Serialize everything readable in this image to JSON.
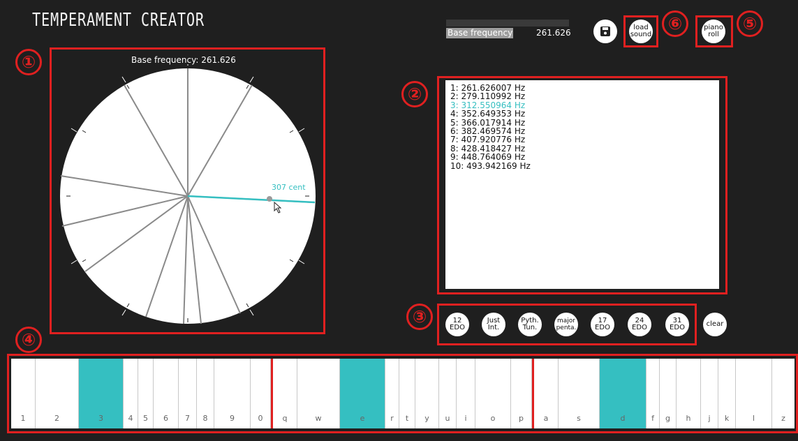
{
  "app": {
    "title": "TEMPERAMENT CREATOR"
  },
  "colors": {
    "accent": "#35bfc1",
    "highlight_red": "#e02020",
    "background": "#1f1f1f"
  },
  "header": {
    "base_frequency_label": "Base frequency",
    "base_frequency_value": "261.626",
    "save_icon": "floppy-disk-icon",
    "load_sound_label": "load\nsound",
    "piano_roll_label": "piano\nroll"
  },
  "annotations": [
    "①",
    "②",
    "③",
    "④",
    "⑤",
    "⑥"
  ],
  "circle_panel": {
    "title": "Base frequency: 261.626",
    "selected_label": "307 cent"
  },
  "frequency_list": {
    "items": [
      "1: 261.626007 Hz",
      "2: 279.110992 Hz",
      "3: 312.550964 Hz",
      "4: 352.649353 Hz",
      "5: 366.017914 Hz",
      "6: 382.469574 Hz",
      "7: 407.920776 Hz",
      "8: 428.418427 Hz",
      "9: 448.764069 Hz",
      "10: 493.942169 Hz"
    ],
    "selected_index": 2
  },
  "presets": {
    "items": [
      "12\nEDO",
      "Just\nInt.",
      "Pyth.\nTun.",
      "major\npenta.",
      "17\nEDO",
      "24\nEDO",
      "31\nEDO"
    ],
    "clear_label": "clear"
  },
  "keyboard": {
    "keys": [
      "1",
      "2",
      "3",
      "4",
      "5",
      "6",
      "7",
      "8",
      "9",
      "0",
      "q",
      "w",
      "e",
      "r",
      "t",
      "y",
      "u",
      "i",
      "o",
      "p",
      "a",
      "s",
      "d",
      "f",
      "g",
      "h",
      "j",
      "k",
      "l",
      "z"
    ],
    "active_keys": [
      "3",
      "e",
      "d"
    ]
  }
}
